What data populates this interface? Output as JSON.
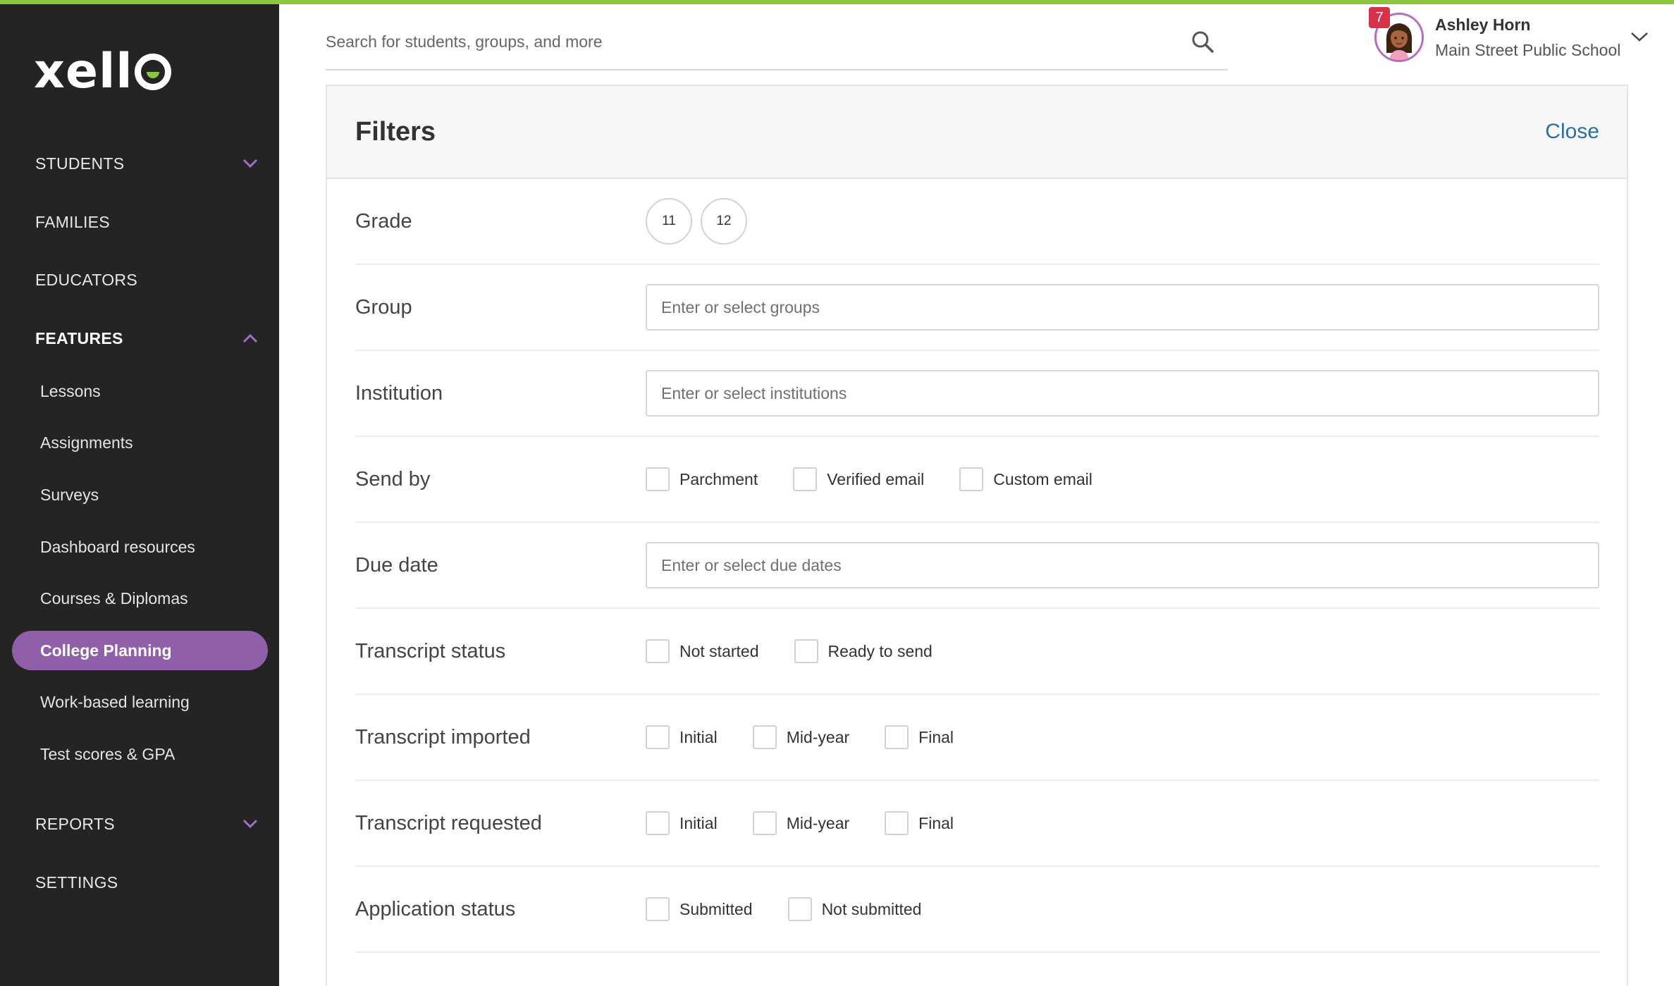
{
  "brand": {
    "logo_prefix": "xell",
    "logo_suffix": "o",
    "accent": "#8dc63f",
    "sidebar_bg": "#242424",
    "active_bg": "#8f5fa9"
  },
  "sidebar": {
    "students": "STUDENTS",
    "families": "FAMILIES",
    "educators": "EDUCATORS",
    "features": "FEATURES",
    "items": [
      {
        "label": "Lessons"
      },
      {
        "label": "Assignments"
      },
      {
        "label": "Surveys"
      },
      {
        "label": "Dashboard resources"
      },
      {
        "label": "Courses & Diplomas"
      },
      {
        "label": "College Planning"
      },
      {
        "label": "Work-based learning"
      },
      {
        "label": "Test scores & GPA"
      }
    ],
    "reports": "REPORTS",
    "settings": "SETTINGS"
  },
  "search": {
    "placeholder": "Search for students, groups, and more",
    "icon": "search-icon"
  },
  "user": {
    "name": "Ashley Horn",
    "school": "Main Street Public School",
    "notification_count": "7"
  },
  "filters": {
    "title": "Filters",
    "close": "Close",
    "grade": {
      "label": "Grade",
      "options": [
        "11",
        "12"
      ]
    },
    "group": {
      "label": "Group",
      "placeholder": "Enter or select groups"
    },
    "institution": {
      "label": "Institution",
      "placeholder": "Enter or select institutions"
    },
    "send_by": {
      "label": "Send by",
      "options": [
        "Parchment",
        "Verified email",
        "Custom email"
      ]
    },
    "due_date": {
      "label": "Due date",
      "placeholder": "Enter or select due dates"
    },
    "transcript_status": {
      "label": "Transcript status",
      "options": [
        "Not started",
        "Ready to send"
      ]
    },
    "transcript_imported": {
      "label": "Transcript imported",
      "options": [
        "Initial",
        "Mid-year",
        "Final"
      ]
    },
    "transcript_requested": {
      "label": "Transcript requested",
      "options": [
        "Initial",
        "Mid-year",
        "Final"
      ]
    },
    "application_status": {
      "label": "Application status",
      "options": [
        "Submitted",
        "Not submitted"
      ]
    }
  }
}
